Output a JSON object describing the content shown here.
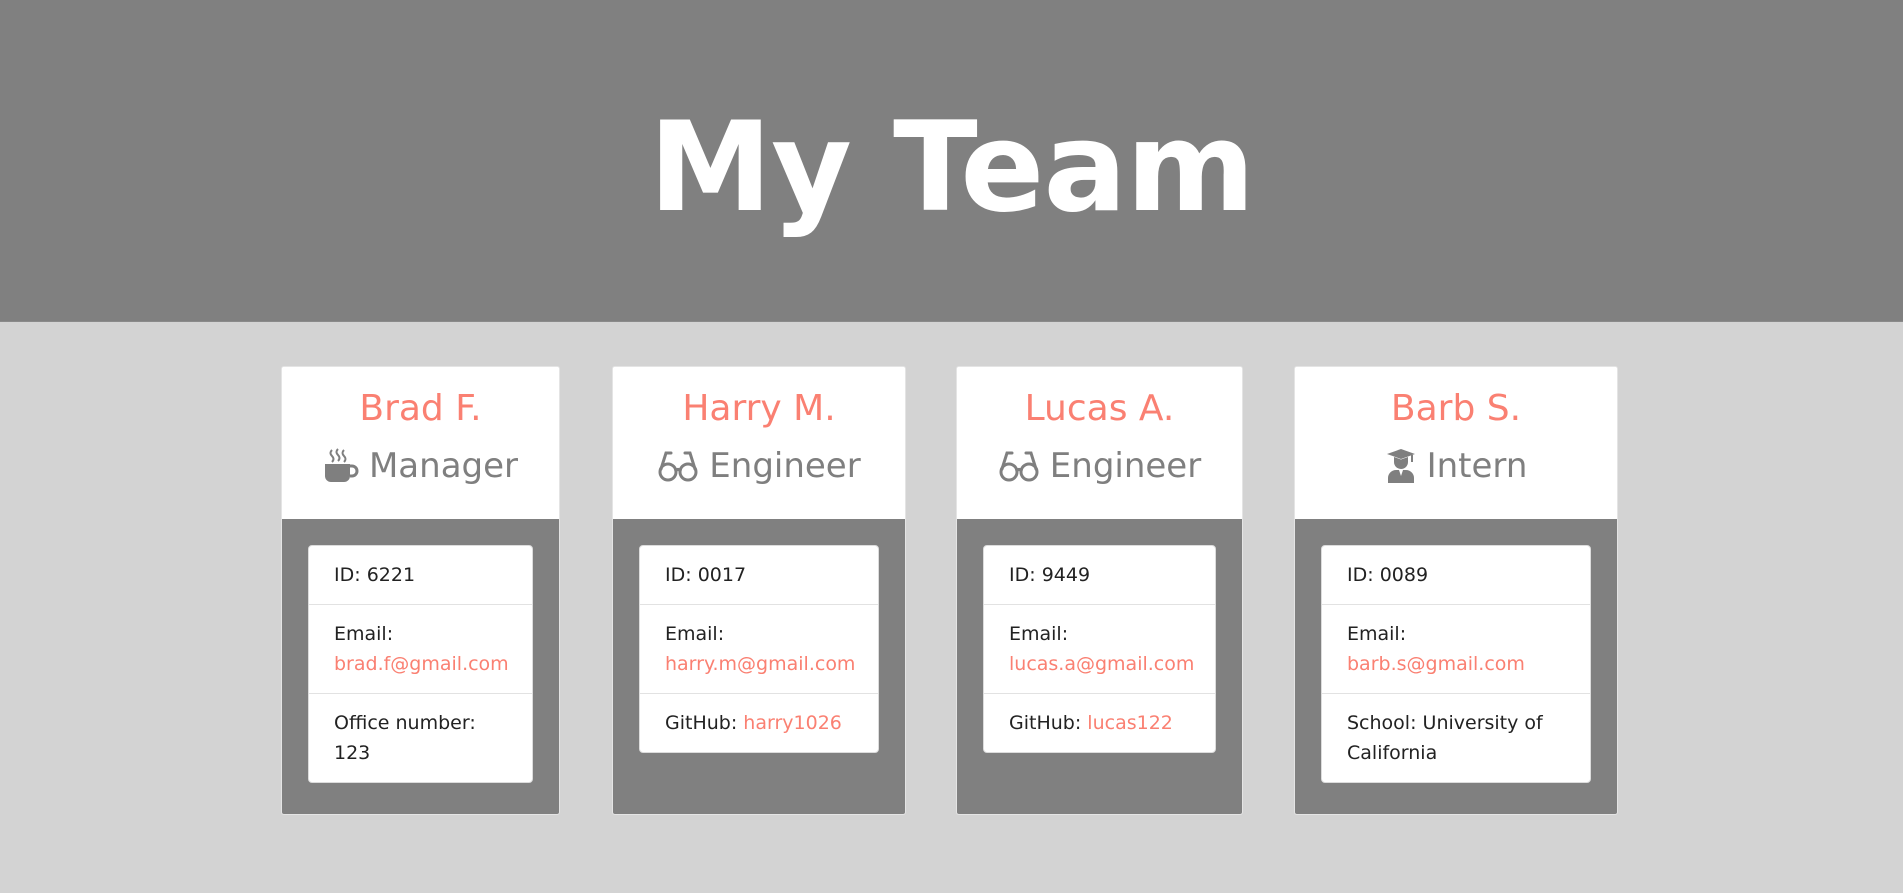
{
  "header": {
    "title": "My Team"
  },
  "labels": {
    "id_prefix": "ID: ",
    "email": "Email:",
    "office": "Office number: ",
    "github": "GitHub: ",
    "school": "School: "
  },
  "colors": {
    "header_bg": "#808080",
    "page_bg": "#d3d3d3",
    "accent": "#fa8072",
    "role_text": "#7f7f7f"
  },
  "employees": [
    {
      "name": "Brad F.",
      "role": "Manager",
      "icon": "coffee-mug-icon",
      "id": "6221",
      "email": "brad.f@gmail.com",
      "office_number": "123"
    },
    {
      "name": "Harry M.",
      "role": "Engineer",
      "icon": "glasses-icon",
      "id": "0017",
      "email": "harry.m@gmail.com",
      "github": "harry1026"
    },
    {
      "name": "Lucas A.",
      "role": "Engineer",
      "icon": "glasses-icon",
      "id": "9449",
      "email": "lucas.a@gmail.com",
      "github": "lucas122"
    },
    {
      "name": "Barb S.",
      "role": "Intern",
      "icon": "graduate-icon",
      "id": "0089",
      "email": "barb.s@gmail.com",
      "school": "University of California"
    }
  ]
}
